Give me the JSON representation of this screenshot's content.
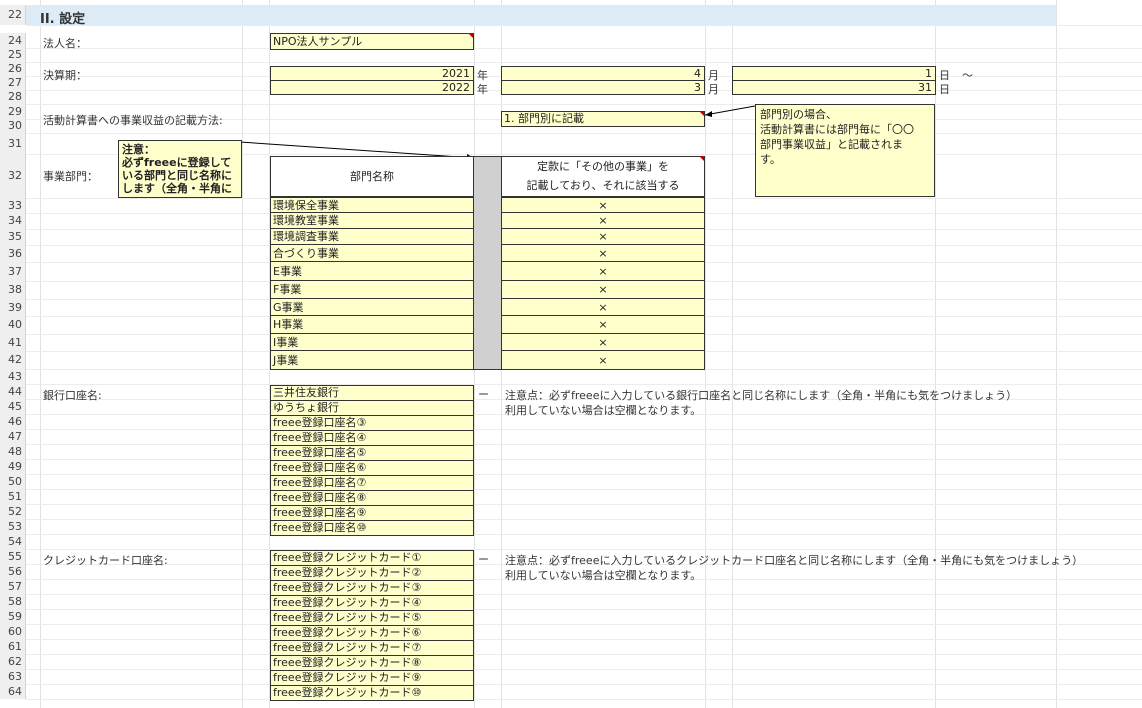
{
  "section_title": "II. 設定",
  "row_numbers": [
    "22",
    "24",
    "25",
    "26",
    "27",
    "28",
    "29",
    "30",
    "31",
    "32",
    "33",
    "34",
    "35",
    "36",
    "37",
    "38",
    "39",
    "40",
    "41",
    "42",
    "43",
    "44",
    "45",
    "46",
    "47",
    "48",
    "49",
    "50",
    "51",
    "52",
    "53",
    "54",
    "55",
    "56",
    "57",
    "58",
    "59",
    "60",
    "61",
    "62",
    "63",
    "64"
  ],
  "corp": {
    "label": "法人名：",
    "value": "NPO法人サンプル"
  },
  "period": {
    "label": "決算期：",
    "start_year": "2021",
    "start_month": "4",
    "start_day": "1",
    "end_year": "2022",
    "end_month": "3",
    "end_day": "31",
    "year_unit": "年",
    "month_unit": "月",
    "day_unit": "日",
    "tilde": "〜"
  },
  "method": {
    "label": "活動計算書への事業収益の記載方法:",
    "value": "1. 部門別に記載"
  },
  "method_comment": "部門別の場合、\n活動計算書には部門毎に「〇〇\n部門事業収益」と記載されま\nす。",
  "dept_comment": {
    "line1": "注意：",
    "line2": "必ずfreeeに登録して",
    "line3": "いる部門と同じ名称に",
    "line4": "します（全角・半角に"
  },
  "departments": {
    "label": "事業部門：",
    "col_name_header": "部門名称",
    "col_other_header_1": "定款に「その他の事業」を",
    "col_other_header_2": "記載しており、それに該当する",
    "names": [
      "環境保全事業",
      "環境教室事業",
      "環境調査事業",
      "合づくり事業",
      "E事業",
      "F事業",
      "G事業",
      "H事業",
      "I事業",
      "J事業"
    ],
    "marks": [
      "×",
      "×",
      "×",
      "×",
      "×",
      "×",
      "×",
      "×",
      "×",
      "×"
    ]
  },
  "bank": {
    "label": "銀行口座名:",
    "dash": "ー",
    "note1": "注意点：必ずfreeeに入力している銀行口座名と同じ名称にします（全角・半角にも気をつけましょう）",
    "note2": "利用していない場合は空欄となります。",
    "names": [
      "三井住友銀行",
      "ゆうちょ銀行",
      "freee登録口座名③",
      "freee登録口座名④",
      "freee登録口座名⑤",
      "freee登録口座名⑥",
      "freee登録口座名⑦",
      "freee登録口座名⑧",
      "freee登録口座名⑨",
      "freee登録口座名⑩"
    ]
  },
  "card": {
    "label": "クレジットカード口座名:",
    "dash": "ー",
    "note1": "注意点：必ずfreeeに入力しているクレジットカード口座名と同じ名称にします（全角・半角にも気をつけましょう）",
    "note2": "利用していない場合は空欄となります。",
    "names": [
      "freee登録クレジットカード①",
      "freee登録クレジットカード②",
      "freee登録クレジットカード③",
      "freee登録クレジットカード④",
      "freee登録クレジットカード⑤",
      "freee登録クレジットカード⑥",
      "freee登録クレジットカード⑦",
      "freee登録クレジットカード⑧",
      "freee登録クレジットカード⑨",
      "freee登録クレジットカード⑩"
    ]
  },
  "colors": {
    "input_fill": "#ffffcc",
    "header_band": "#ddebf7",
    "gray_col": "#d0d0d0",
    "comment_marker": "#c00000"
  }
}
